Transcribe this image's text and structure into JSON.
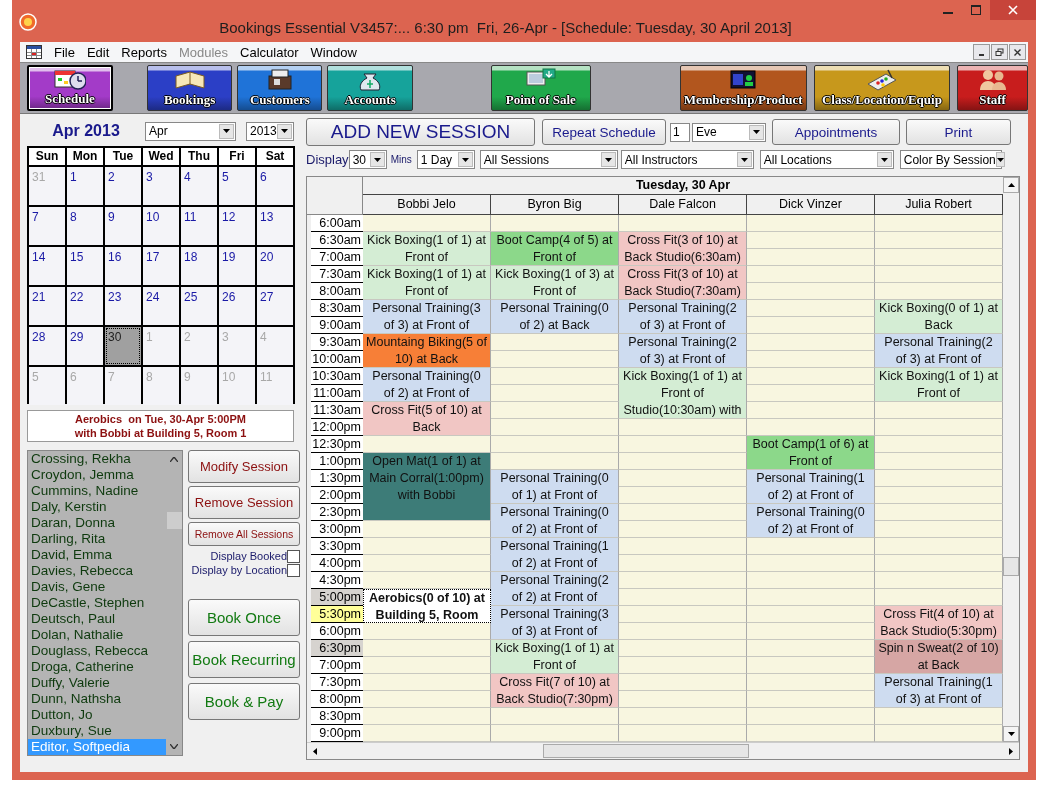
{
  "window": {
    "title": "Bookings Essential V3457:... 6:30 pm  Fri, 26-Apr - [Schedule: Tuesday, 30 April 2013]"
  },
  "menu": [
    {
      "label": "File",
      "disabled": false
    },
    {
      "label": "Edit",
      "disabled": false
    },
    {
      "label": "Reports",
      "disabled": false
    },
    {
      "label": "Modules",
      "disabled": true
    },
    {
      "label": "Calculator",
      "disabled": false
    },
    {
      "label": "Window",
      "disabled": false
    }
  ],
  "toolbar": [
    {
      "label": "Schedule",
      "selected": true,
      "color": "#a33bc8"
    },
    {
      "label": "Bookings",
      "selected": false,
      "color": "#2b3fc6"
    },
    {
      "label": "Customers",
      "selected": false,
      "color": "#1f73d8"
    },
    {
      "label": "Accounts",
      "selected": false,
      "color": "#16a39b"
    },
    {
      "label": "Point of Sale",
      "selected": false,
      "color": "#20a84b"
    },
    {
      "label": "Membership/Product",
      "selected": false,
      "color": "#b2561e"
    },
    {
      "label": "Class/Location/Equip",
      "selected": false,
      "color": "#c7981c"
    },
    {
      "label": "Staff",
      "selected": false,
      "color": "#c81d1d"
    }
  ],
  "calendar": {
    "title": "Apr 2013",
    "month": "Apr",
    "year": "2013",
    "weekdays": [
      "Sun",
      "Mon",
      "Tue",
      "Wed",
      "Thu",
      "Fri",
      "Sat"
    ],
    "weeks": [
      [
        {
          "day": "31",
          "in_month": false,
          "selected": false
        },
        {
          "day": "1",
          "in_month": true,
          "selected": false
        },
        {
          "day": "2",
          "in_month": true,
          "selected": false
        },
        {
          "day": "3",
          "in_month": true,
          "selected": false
        },
        {
          "day": "4",
          "in_month": true,
          "selected": false
        },
        {
          "day": "5",
          "in_month": true,
          "selected": false
        },
        {
          "day": "6",
          "in_month": true,
          "selected": false
        }
      ],
      [
        {
          "day": "7",
          "in_month": true,
          "selected": false
        },
        {
          "day": "8",
          "in_month": true,
          "selected": false
        },
        {
          "day": "9",
          "in_month": true,
          "selected": false
        },
        {
          "day": "10",
          "in_month": true,
          "selected": false
        },
        {
          "day": "11",
          "in_month": true,
          "selected": false
        },
        {
          "day": "12",
          "in_month": true,
          "selected": false
        },
        {
          "day": "13",
          "in_month": true,
          "selected": false
        }
      ],
      [
        {
          "day": "14",
          "in_month": true,
          "selected": false
        },
        {
          "day": "15",
          "in_month": true,
          "selected": false
        },
        {
          "day": "16",
          "in_month": true,
          "selected": false
        },
        {
          "day": "17",
          "in_month": true,
          "selected": false
        },
        {
          "day": "18",
          "in_month": true,
          "selected": false
        },
        {
          "day": "19",
          "in_month": true,
          "selected": false
        },
        {
          "day": "20",
          "in_month": true,
          "selected": false
        }
      ],
      [
        {
          "day": "21",
          "in_month": true,
          "selected": false
        },
        {
          "day": "22",
          "in_month": true,
          "selected": false
        },
        {
          "day": "23",
          "in_month": true,
          "selected": false
        },
        {
          "day": "24",
          "in_month": true,
          "selected": false
        },
        {
          "day": "25",
          "in_month": true,
          "selected": false
        },
        {
          "day": "26",
          "in_month": true,
          "selected": false
        },
        {
          "day": "27",
          "in_month": true,
          "selected": false
        }
      ],
      [
        {
          "day": "28",
          "in_month": true,
          "selected": false
        },
        {
          "day": "29",
          "in_month": true,
          "selected": false
        },
        {
          "day": "30",
          "in_month": true,
          "selected": true
        },
        {
          "day": "1",
          "in_month": false,
          "selected": false
        },
        {
          "day": "2",
          "in_month": false,
          "selected": false
        },
        {
          "day": "3",
          "in_month": false,
          "selected": false
        },
        {
          "day": "4",
          "in_month": false,
          "selected": false
        }
      ],
      [
        {
          "day": "5",
          "in_month": false,
          "selected": false
        },
        {
          "day": "6",
          "in_month": false,
          "selected": false
        },
        {
          "day": "7",
          "in_month": false,
          "selected": false
        },
        {
          "day": "8",
          "in_month": false,
          "selected": false
        },
        {
          "day": "9",
          "in_month": false,
          "selected": false
        },
        {
          "day": "10",
          "in_month": false,
          "selected": false
        },
        {
          "day": "11",
          "in_month": false,
          "selected": false
        }
      ]
    ]
  },
  "session_info": [
    "Aerobics  on Tue, 30-Apr 5:00PM",
    "with Bobbi at Building 5, Room 1"
  ],
  "customers": [
    {
      "name": "Crossing, Rekha",
      "selected": false
    },
    {
      "name": "Croydon, Jemma",
      "selected": false
    },
    {
      "name": "Cummins, Nadine",
      "selected": false
    },
    {
      "name": "Daly, Kerstin",
      "selected": false
    },
    {
      "name": "Daran, Donna",
      "selected": false
    },
    {
      "name": "Darling, Rita",
      "selected": false
    },
    {
      "name": "David, Emma",
      "selected": false
    },
    {
      "name": "Davies, Rebecca",
      "selected": false
    },
    {
      "name": "Davis, Gene",
      "selected": false
    },
    {
      "name": "DeCastle, Stephen",
      "selected": false
    },
    {
      "name": "Deutsch, Paul",
      "selected": false
    },
    {
      "name": "Dolan, Nathalie",
      "selected": false
    },
    {
      "name": "Douglass, Rebecca",
      "selected": false
    },
    {
      "name": "Droga, Catherine",
      "selected": false
    },
    {
      "name": "Duffy, Valerie",
      "selected": false
    },
    {
      "name": "Dunn, Nathsha",
      "selected": false
    },
    {
      "name": "Dutton, Jo",
      "selected": false
    },
    {
      "name": "Duxbury, Sue",
      "selected": false
    },
    {
      "name": "Editor, Softpedia",
      "selected": true
    }
  ],
  "session_buttons": [
    {
      "label": "Modify Session",
      "kind": "session"
    },
    {
      "label": "Remove Session",
      "kind": "session"
    },
    {
      "label": "Remove All Sessions",
      "kind": "small"
    }
  ],
  "options": [
    {
      "label": "Display Booked",
      "checked": false
    },
    {
      "label": "Display by Location",
      "checked": false
    }
  ],
  "book_buttons": [
    "Book Once",
    "Book Recurring",
    "Book & Pay"
  ],
  "actions": {
    "add": "ADD NEW SESSION",
    "repeat": "Repeat Schedule",
    "repeat_count": "1",
    "repeat_period": "Eve",
    "appointments": "Appointments",
    "print": "Print"
  },
  "filters": {
    "display_label": "Display",
    "interval": "30",
    "mins_label": "Mins",
    "span": "1 Day",
    "sessions": "All Sessions",
    "instructors": "All Instructors",
    "locations": "All Locations",
    "coloring": "Color By Session"
  },
  "schedule": {
    "date": "Tuesday, 30 Apr",
    "times": [
      {
        "label": "6:00am",
        "highlighted": false,
        "current": false
      },
      {
        "label": "6:30am",
        "highlighted": false,
        "current": false
      },
      {
        "label": "7:00am",
        "highlighted": false,
        "current": false
      },
      {
        "label": "7:30am",
        "highlighted": false,
        "current": false
      },
      {
        "label": "8:00am",
        "highlighted": false,
        "current": false
      },
      {
        "label": "8:30am",
        "highlighted": false,
        "current": false
      },
      {
        "label": "9:00am",
        "highlighted": false,
        "current": false
      },
      {
        "label": "9:30am",
        "highlighted": false,
        "current": false
      },
      {
        "label": "10:00am",
        "highlighted": false,
        "current": false
      },
      {
        "label": "10:30am",
        "highlighted": false,
        "current": false
      },
      {
        "label": "11:00am",
        "highlighted": false,
        "current": false
      },
      {
        "label": "11:30am",
        "highlighted": false,
        "current": false
      },
      {
        "label": "12:00pm",
        "highlighted": false,
        "current": false
      },
      {
        "label": "12:30pm",
        "highlighted": false,
        "current": false
      },
      {
        "label": "1:00pm",
        "highlighted": false,
        "current": false
      },
      {
        "label": "1:30pm",
        "highlighted": false,
        "current": false
      },
      {
        "label": "2:00pm",
        "highlighted": false,
        "current": false
      },
      {
        "label": "2:30pm",
        "highlighted": false,
        "current": false
      },
      {
        "label": "3:00pm",
        "highlighted": false,
        "current": false
      },
      {
        "label": "3:30pm",
        "highlighted": false,
        "current": false
      },
      {
        "label": "4:00pm",
        "highlighted": false,
        "current": false
      },
      {
        "label": "4:30pm",
        "highlighted": false,
        "current": false
      },
      {
        "label": "5:00pm",
        "highlighted": true,
        "current": false
      },
      {
        "label": "5:30pm",
        "highlighted": false,
        "current": true
      },
      {
        "label": "6:00pm",
        "highlighted": false,
        "current": false
      },
      {
        "label": "6:30pm",
        "highlighted": true,
        "current": false
      },
      {
        "label": "7:00pm",
        "highlighted": false,
        "current": false
      },
      {
        "label": "7:30pm",
        "highlighted": false,
        "current": false
      },
      {
        "label": "8:00pm",
        "highlighted": false,
        "current": false
      },
      {
        "label": "8:30pm",
        "highlighted": false,
        "current": false
      },
      {
        "label": "9:00pm",
        "highlighted": false,
        "current": false
      }
    ],
    "columns": [
      {
        "name": "Bobbi Jelo",
        "blocks": [
          {
            "kind": "free"
          },
          {
            "kind": "session",
            "text": "Kick Boxing(1 of 1) at Front of",
            "color": "#d4edd4",
            "selected": false
          },
          {
            "kind": "continued"
          },
          {
            "kind": "session",
            "text": "Kick Boxing(1 of 1) at Front of",
            "color": "#d4edd4",
            "selected": false
          },
          {
            "kind": "continued"
          },
          {
            "kind": "session",
            "text": "Personal Training(3 of 3) at Front of",
            "color": "#cedcf0",
            "selected": false
          },
          {
            "kind": "continued"
          },
          {
            "kind": "session",
            "text": "Mountaing Biking(5 of 10) at Back",
            "color": "#f77f37",
            "selected": false
          },
          {
            "kind": "continued"
          },
          {
            "kind": "session",
            "text": "Personal Training(0 of 2) at Front of",
            "color": "#cedcf0",
            "selected": false
          },
          {
            "kind": "continued"
          },
          {
            "kind": "session",
            "text": "Cross Fit(5 of 10) at Back",
            "color": "#f1c6c4",
            "selected": false
          },
          {
            "kind": "continued"
          },
          {
            "kind": "free"
          },
          {
            "kind": "session",
            "text": "Open Mat(1 of 1) at Main Corral(1:00pm) with Bobbi",
            "color": "#3d7c78",
            "selected": false
          },
          {
            "kind": "continued"
          },
          {
            "kind": "continued"
          },
          {
            "kind": "continued"
          },
          {
            "kind": "free"
          },
          {
            "kind": "free"
          },
          {
            "kind": "free"
          },
          {
            "kind": "free"
          },
          {
            "kind": "session",
            "text": "Aerobics(0 of 10) at Building 5, Room",
            "color": "#ffffff",
            "selected": true
          },
          {
            "kind": "continued"
          },
          {
            "kind": "free"
          },
          {
            "kind": "free"
          },
          {
            "kind": "free"
          },
          {
            "kind": "free"
          },
          {
            "kind": "free"
          },
          {
            "kind": "free"
          },
          {
            "kind": "free"
          }
        ]
      },
      {
        "name": "Byron Big",
        "blocks": [
          {
            "kind": "free"
          },
          {
            "kind": "session",
            "text": "Boot Camp(4 of 5) at Front of",
            "color": "#8cd88a",
            "selected": false
          },
          {
            "kind": "continued"
          },
          {
            "kind": "session",
            "text": "Kick Boxing(1 of 3) at Front of",
            "color": "#d4edd4",
            "selected": false
          },
          {
            "kind": "continued"
          },
          {
            "kind": "session",
            "text": "Personal Training(0 of 2) at Back",
            "color": "#cedcf0",
            "selected": false
          },
          {
            "kind": "continued"
          },
          {
            "kind": "free"
          },
          {
            "kind": "free"
          },
          {
            "kind": "free"
          },
          {
            "kind": "free"
          },
          {
            "kind": "free"
          },
          {
            "kind": "free"
          },
          {
            "kind": "free"
          },
          {
            "kind": "free"
          },
          {
            "kind": "session",
            "text": "Personal Training(0 of 1) at Front of",
            "color": "#cedcf0",
            "selected": false
          },
          {
            "kind": "continued"
          },
          {
            "kind": "session",
            "text": "Personal Training(0 of 2) at Front of",
            "color": "#cedcf0",
            "selected": false
          },
          {
            "kind": "continued"
          },
          {
            "kind": "session",
            "text": "Personal Training(1 of 2) at Front of",
            "color": "#cedcf0",
            "selected": false
          },
          {
            "kind": "continued"
          },
          {
            "kind": "session",
            "text": "Personal Training(2 of 2) at Front of",
            "color": "#cedcf0",
            "selected": false
          },
          {
            "kind": "continued"
          },
          {
            "kind": "session",
            "text": "Personal Training(3 of 3) at Front of",
            "color": "#cedcf0",
            "selected": false
          },
          {
            "kind": "continued"
          },
          {
            "kind": "session",
            "text": "Kick Boxing(1 of 1) at Front of",
            "color": "#d4edd4",
            "selected": false
          },
          {
            "kind": "continued"
          },
          {
            "kind": "session",
            "text": "Cross Fit(7 of 10) at Back Studio(7:30pm)",
            "color": "#f1c6c4",
            "selected": false
          },
          {
            "kind": "continued"
          },
          {
            "kind": "free"
          },
          {
            "kind": "free"
          }
        ]
      },
      {
        "name": "Dale Falcon",
        "blocks": [
          {
            "kind": "free"
          },
          {
            "kind": "session",
            "text": "Cross Fit(3 of 10) at Back Studio(6:30am)",
            "color": "#f1c6c4",
            "selected": false
          },
          {
            "kind": "continued"
          },
          {
            "kind": "session",
            "text": "Cross Fit(3 of 10) at Back Studio(7:30am)",
            "color": "#f1c6c4",
            "selected": false
          },
          {
            "kind": "continued"
          },
          {
            "kind": "session",
            "text": "Personal Training(2 of 3) at Front of",
            "color": "#cedcf0",
            "selected": false
          },
          {
            "kind": "continued"
          },
          {
            "kind": "session",
            "text": "Personal Training(2 of 3) at Front of",
            "color": "#cedcf0",
            "selected": false
          },
          {
            "kind": "continued"
          },
          {
            "kind": "session",
            "text": "Kick Boxing(1 of 1) at Front of Studio(10:30am) with",
            "color": "#d4edd4",
            "selected": false
          },
          {
            "kind": "continued"
          },
          {
            "kind": "continued"
          },
          {
            "kind": "free"
          },
          {
            "kind": "free"
          },
          {
            "kind": "free"
          },
          {
            "kind": "free"
          },
          {
            "kind": "free"
          },
          {
            "kind": "free"
          },
          {
            "kind": "free"
          },
          {
            "kind": "free"
          },
          {
            "kind": "free"
          },
          {
            "kind": "free"
          },
          {
            "kind": "free"
          },
          {
            "kind": "free"
          },
          {
            "kind": "free"
          },
          {
            "kind": "free"
          },
          {
            "kind": "free"
          },
          {
            "kind": "free"
          },
          {
            "kind": "free"
          },
          {
            "kind": "free"
          },
          {
            "kind": "free"
          }
        ]
      },
      {
        "name": "Dick Vinzer",
        "blocks": [
          {
            "kind": "free"
          },
          {
            "kind": "free"
          },
          {
            "kind": "free"
          },
          {
            "kind": "free"
          },
          {
            "kind": "free"
          },
          {
            "kind": "free"
          },
          {
            "kind": "free"
          },
          {
            "kind": "free"
          },
          {
            "kind": "free"
          },
          {
            "kind": "free"
          },
          {
            "kind": "free"
          },
          {
            "kind": "free"
          },
          {
            "kind": "free"
          },
          {
            "kind": "session",
            "text": "Boot Camp(1 of 6) at Front of",
            "color": "#8cd88a",
            "selected": false
          },
          {
            "kind": "continued"
          },
          {
            "kind": "session",
            "text": "Personal Training(1 of 2) at Front of",
            "color": "#cedcf0",
            "selected": false
          },
          {
            "kind": "continued"
          },
          {
            "kind": "session",
            "text": "Personal Training(0 of 2) at Front of",
            "color": "#cedcf0",
            "selected": false
          },
          {
            "kind": "continued"
          },
          {
            "kind": "free"
          },
          {
            "kind": "free"
          },
          {
            "kind": "free"
          },
          {
            "kind": "free"
          },
          {
            "kind": "free"
          },
          {
            "kind": "free"
          },
          {
            "kind": "free"
          },
          {
            "kind": "free"
          },
          {
            "kind": "free"
          },
          {
            "kind": "free"
          },
          {
            "kind": "free"
          },
          {
            "kind": "free"
          }
        ]
      },
      {
        "name": "Julia Robert",
        "blocks": [
          {
            "kind": "free"
          },
          {
            "kind": "free"
          },
          {
            "kind": "free"
          },
          {
            "kind": "free"
          },
          {
            "kind": "free"
          },
          {
            "kind": "session",
            "text": "Kick Boxing(0 of 1) at Back",
            "color": "#d4edd4",
            "selected": false
          },
          {
            "kind": "continued"
          },
          {
            "kind": "session",
            "text": "Personal Training(2 of 3) at Front of",
            "color": "#cedcf0",
            "selected": false
          },
          {
            "kind": "continued"
          },
          {
            "kind": "session",
            "text": "Kick Boxing(1 of 1) at Front of",
            "color": "#d4edd4",
            "selected": false
          },
          {
            "kind": "continued"
          },
          {
            "kind": "free"
          },
          {
            "kind": "free"
          },
          {
            "kind": "free"
          },
          {
            "kind": "free"
          },
          {
            "kind": "free"
          },
          {
            "kind": "free"
          },
          {
            "kind": "free"
          },
          {
            "kind": "free"
          },
          {
            "kind": "free"
          },
          {
            "kind": "free"
          },
          {
            "kind": "free"
          },
          {
            "kind": "free"
          },
          {
            "kind": "session",
            "text": "Cross Fit(4 of 10) at Back Studio(5:30pm)",
            "color": "#f1c6c4",
            "selected": false
          },
          {
            "kind": "continued"
          },
          {
            "kind": "session",
            "text": "Spin n Sweat(2 of 10) at Back",
            "color": "#d6a6a4",
            "selected": false
          },
          {
            "kind": "continued"
          },
          {
            "kind": "session",
            "text": "Personal Training(1 of 3) at Front of",
            "color": "#cedcf0",
            "selected": false
          },
          {
            "kind": "continued"
          },
          {
            "kind": "free"
          },
          {
            "kind": "free"
          }
        ]
      }
    ]
  }
}
